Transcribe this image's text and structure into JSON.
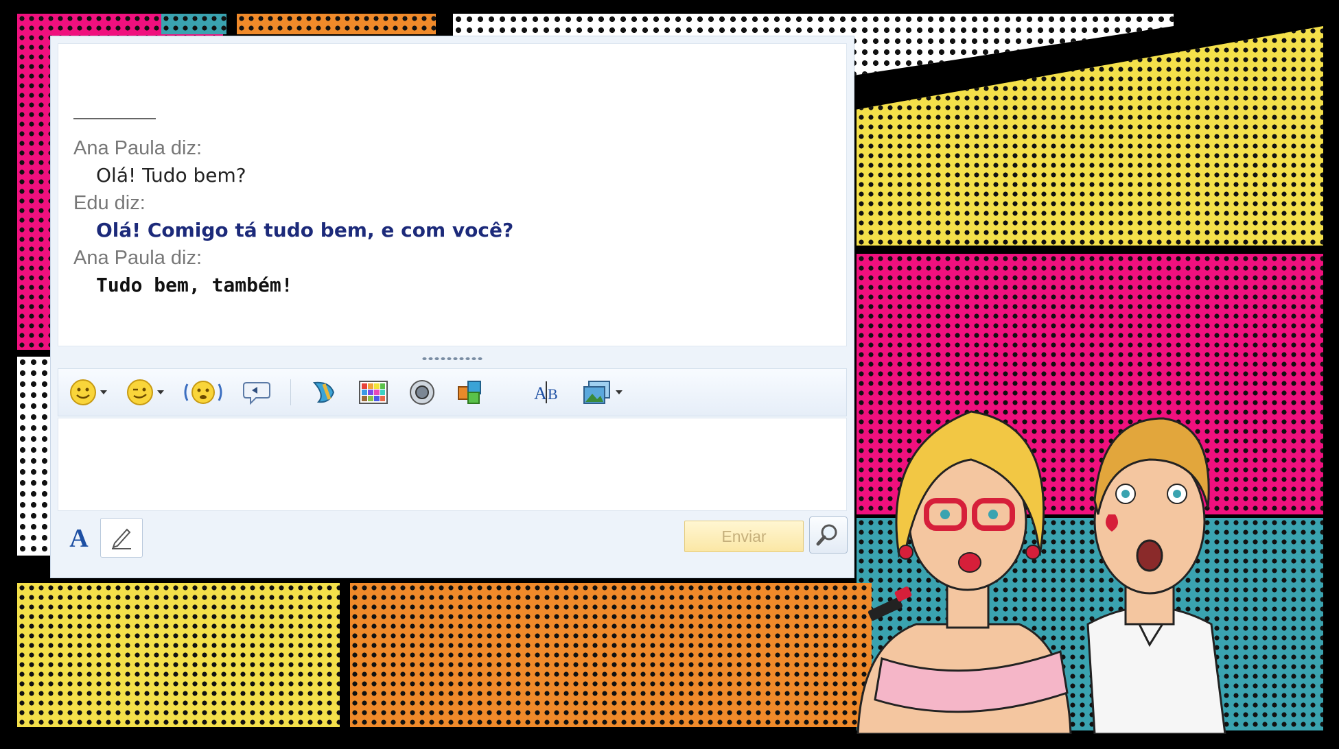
{
  "chat": {
    "messages": [
      {
        "sender": "Ana Paula diz:",
        "text": "Olá! Tudo bem?"
      },
      {
        "sender": "Edu diz:",
        "text": "Olá! Comigo tá tudo bem, e com você?"
      },
      {
        "sender": "Ana Paula diz:",
        "text": "Tudo bem, também!"
      }
    ]
  },
  "toolbar": {
    "icons": [
      "emoticon-icon",
      "wink-icon",
      "nudge-icon",
      "voice-clip-icon",
      "ink-icon",
      "background-icon",
      "sound-icon",
      "game-icon",
      "text-style-icon",
      "image-share-icon"
    ]
  },
  "bottom": {
    "font_label": "A",
    "send_label": "Enviar"
  },
  "colors": {
    "sender": "#777777",
    "message_edu": "#1c2a7a",
    "send_button": "#fbe7a5",
    "pink": "#f0107e",
    "orange": "#f08a2a",
    "yellow": "#f4e04a",
    "teal": "#3aa3b0"
  }
}
